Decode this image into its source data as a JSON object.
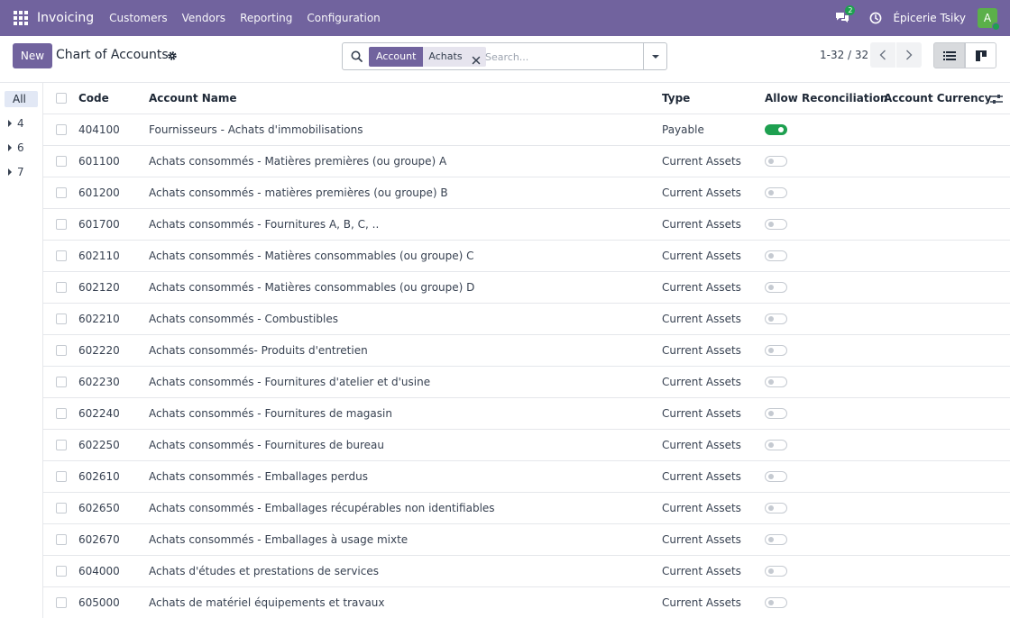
{
  "navbar": {
    "app_name": "Invoicing",
    "menu": [
      "Customers",
      "Vendors",
      "Reporting",
      "Configuration"
    ],
    "chat_count": "2",
    "company": "Épicerie Tsiky",
    "avatar_initial": "A",
    "color": "#71639e"
  },
  "control": {
    "new_label": "New",
    "title": "Chart of Accounts",
    "facet_label": "Account",
    "facet_value": "Achats",
    "search_placeholder": "Search...",
    "pager": "1-32 / 32"
  },
  "sidebar": {
    "all_label": "All",
    "groups": [
      "4",
      "6",
      "7"
    ]
  },
  "table": {
    "columns": {
      "code": "Code",
      "name": "Account Name",
      "type": "Type",
      "reconcile": "Allow Reconciliation",
      "currency": "Account Currency"
    },
    "rows": [
      {
        "code": "404100",
        "name": "Fournisseurs - Achats d'immobilisations",
        "type": "Payable",
        "reconcile": true
      },
      {
        "code": "601100",
        "name": "Achats consommés - Matières premières (ou groupe) A",
        "type": "Current Assets",
        "reconcile": false
      },
      {
        "code": "601200",
        "name": "Achats consommés - matières premières (ou groupe) B",
        "type": "Current Assets",
        "reconcile": false
      },
      {
        "code": "601700",
        "name": "Achats consommés - Fournitures A, B, C, ..",
        "type": "Current Assets",
        "reconcile": false
      },
      {
        "code": "602110",
        "name": "Achats consommés - Matières consommables (ou groupe) C",
        "type": "Current Assets",
        "reconcile": false
      },
      {
        "code": "602120",
        "name": "Achats consommés - Matières consommables (ou groupe) D",
        "type": "Current Assets",
        "reconcile": false
      },
      {
        "code": "602210",
        "name": "Achats consommés - Combustibles",
        "type": "Current Assets",
        "reconcile": false
      },
      {
        "code": "602220",
        "name": "Achats consommés- Produits d'entretien",
        "type": "Current Assets",
        "reconcile": false
      },
      {
        "code": "602230",
        "name": "Achats consommés - Fournitures d'atelier et d'usine",
        "type": "Current Assets",
        "reconcile": false
      },
      {
        "code": "602240",
        "name": "Achats consommés - Fournitures de magasin",
        "type": "Current Assets",
        "reconcile": false
      },
      {
        "code": "602250",
        "name": "Achats consommés - Fournitures de bureau",
        "type": "Current Assets",
        "reconcile": false
      },
      {
        "code": "602610",
        "name": "Achats consommés - Emballages perdus",
        "type": "Current Assets",
        "reconcile": false
      },
      {
        "code": "602650",
        "name": "Achats consommés - Emballages récupérables non identifiables",
        "type": "Current Assets",
        "reconcile": false
      },
      {
        "code": "602670",
        "name": "Achats consommés - Emballages à usage mixte",
        "type": "Current Assets",
        "reconcile": false
      },
      {
        "code": "604000",
        "name": "Achats d'études et prestations de services",
        "type": "Current Assets",
        "reconcile": false
      },
      {
        "code": "605000",
        "name": "Achats de matériel équipements et travaux",
        "type": "Current Assets",
        "reconcile": false
      }
    ]
  }
}
